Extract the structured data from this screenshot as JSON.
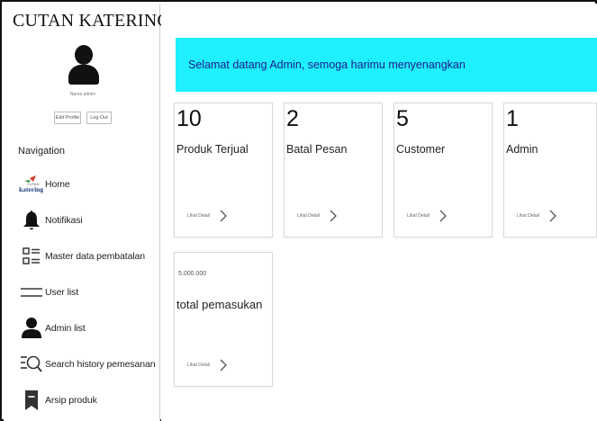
{
  "sidebar": {
    "brand": "CUTAN KATERING",
    "admin_name": "Nama admin",
    "edit_profile": "Edit Profile",
    "log_out": "Log Out",
    "nav_title": "Navigation",
    "items": [
      {
        "label": "Home",
        "icon": "katering-logo-icon"
      },
      {
        "label": "Notifikasi",
        "icon": "bell-icon"
      },
      {
        "label": "Master data pembatalan",
        "icon": "list-icon"
      },
      {
        "label": "User list",
        "icon": "user-list-icon"
      },
      {
        "label": "Admin list",
        "icon": "admin-icon"
      },
      {
        "label": "Search history pemesanan",
        "icon": "search-history-icon"
      },
      {
        "label": "Arsip produk",
        "icon": "bookmark-icon"
      }
    ],
    "logo_text_small": "CUTAN",
    "logo_text": "katering"
  },
  "main": {
    "banner": "Selamat datang Admin, semoga harimu menyenangkan",
    "banner_color": "#1ff0ff",
    "cards": [
      {
        "number": "10",
        "caption": "Produk Terjual",
        "detail": "Lihat Detail"
      },
      {
        "number": "2",
        "caption": "Batal Pesan",
        "detail": "Lihat Detail"
      },
      {
        "number": "5",
        "caption": "Customer",
        "detail": "Lihat Detail"
      },
      {
        "number": "1",
        "caption": "Admin",
        "detail": "Lihat Detail"
      }
    ],
    "income_card": {
      "amount": "5.000.000",
      "caption": "total pemasukan",
      "detail": "Lihat Detail"
    }
  }
}
